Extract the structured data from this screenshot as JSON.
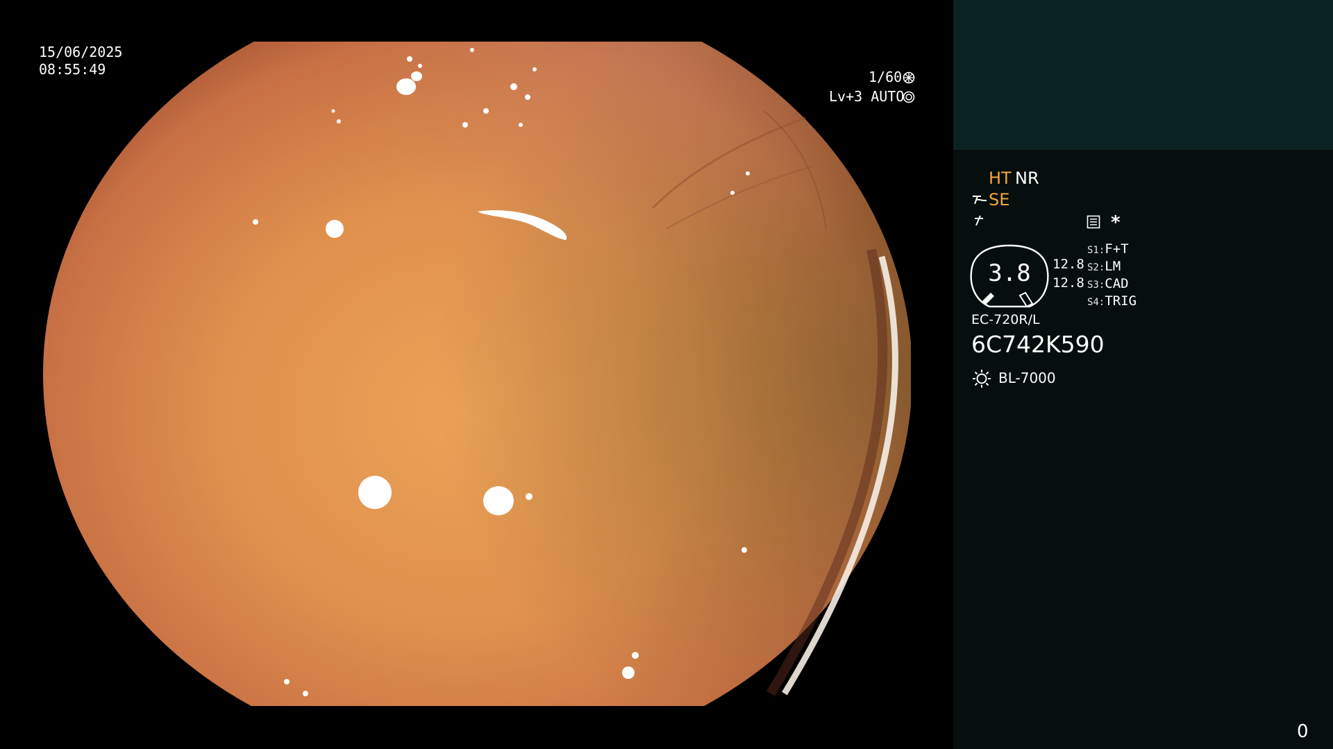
{
  "video": {
    "date": "15/06/2025",
    "time": "08:55:49",
    "shutter": "1/60",
    "shutter_icon": "shutter-icon",
    "iris_level": "Lv+3 AUTO",
    "iris_icon": "iris-icon"
  },
  "panel": {
    "ht": "HT",
    "nr": "NR",
    "se": "SE",
    "se_icon": "structure-enhancement-icon",
    "color_icon": "color-mode-icon",
    "menu_icon": "settings-list-icon",
    "asterisk": "*",
    "zoom": {
      "value": "3.8",
      "upper": "12.8",
      "lower": "12.8"
    },
    "switches": [
      {
        "key": "S1:",
        "value": "F+T"
      },
      {
        "key": "S2:",
        "value": "LM"
      },
      {
        "key": "S3:",
        "value": "CAD"
      },
      {
        "key": "S4:",
        "value": "TRIG"
      }
    ],
    "scope_model": "EC-720R/L",
    "serial": "6C742K590",
    "light_icon": "light-source-icon",
    "light_source": "BL-7000",
    "counter": "0"
  },
  "colors": {
    "mucosa_center": "#e89a4a",
    "mucosa_edge": "#b05a32",
    "panel_bg": "#060e0e",
    "panel_top_bg": "#0b2222",
    "accent_orange": "#f2a63b"
  }
}
